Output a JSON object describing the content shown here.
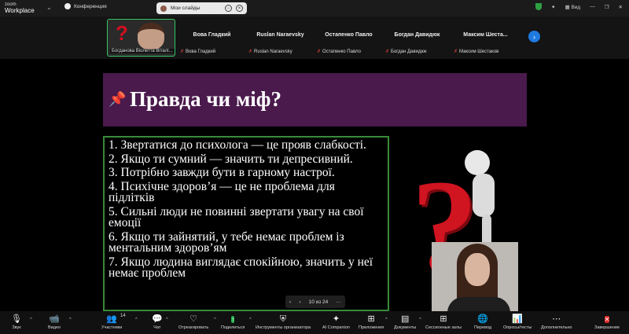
{
  "app": {
    "logo_top": "zoom",
    "logo_bottom": "Workplace"
  },
  "topbar": {
    "meeting_label": "Конференция",
    "screen_share_label": "Мои слайды",
    "view_label": "Вид",
    "colors": {
      "shield": "#2ea043"
    }
  },
  "participants": [
    {
      "name": "",
      "label": "Богданова Віолетта Віталі..."
    },
    {
      "name": "Вова Гладкий",
      "label": "Вова Гладкий"
    },
    {
      "name": "Ruslan Naraevsky",
      "label": "Ruslan Naraevsky"
    },
    {
      "name": "Остапенко Павло",
      "label": "Остапенко Павло"
    },
    {
      "name": "Богдан Давидюк",
      "label": "Богдан Давидюк"
    },
    {
      "name": "Максим  Шеста...",
      "label": "Максим Шестаков"
    }
  ],
  "slide": {
    "title": "Правда чи міф?",
    "items": [
      "1. Звертатися до психолога — це прояв слабкості.",
      "2. Якщо ти сумний — значить ти депресивний.",
      "3. Потрібно завжди бути в гарному настрої.",
      "4. Психічне здоров’я — це не проблема для підлітків",
      "5. Сильні люди не повинні звертати увагу на свої емоції",
      "6. Якщо ти зайнятий, у тебе немає проблем із ментальним здоров’ям",
      "7. Якщо людина виглядає спокійною, значить у неї немає проблем"
    ],
    "page_indicator": "10 из 24",
    "colors": {
      "title_band": "#4a1a4c",
      "border": "#3a8a3a",
      "question_mark": "#d01420"
    }
  },
  "toolbar": {
    "audio": "Звук",
    "video": "Видео",
    "participants": "Участники",
    "participants_count": "14",
    "chat": "Чат",
    "react": "Отреагировать",
    "share": "Поделиться",
    "host_tools": "Инструменты организатора",
    "ai": "AI Companion",
    "apps": "Приложения",
    "docs": "Документы",
    "breakout": "Сессионные залы",
    "translate": "Перевод",
    "polls": "Опросы/тесты",
    "more": "Дополнительно",
    "end": "Завершение"
  }
}
